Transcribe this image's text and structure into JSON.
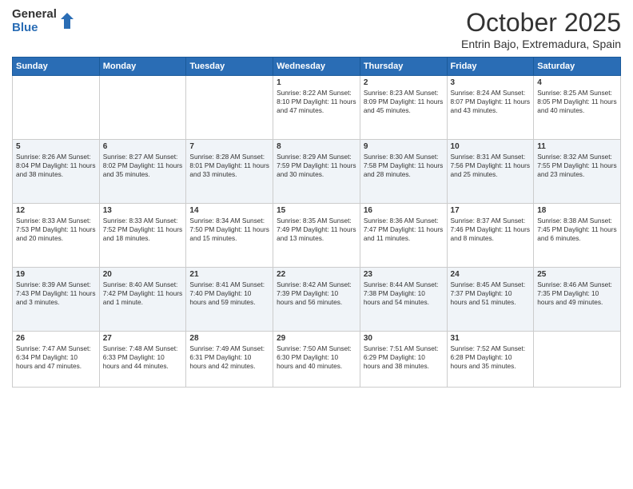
{
  "logo": {
    "general": "General",
    "blue": "Blue"
  },
  "title": "October 2025",
  "subtitle": "Entrin Bajo, Extremadura, Spain",
  "days_of_week": [
    "Sunday",
    "Monday",
    "Tuesday",
    "Wednesday",
    "Thursday",
    "Friday",
    "Saturday"
  ],
  "weeks": [
    [
      {
        "day": "",
        "info": ""
      },
      {
        "day": "",
        "info": ""
      },
      {
        "day": "",
        "info": ""
      },
      {
        "day": "1",
        "info": "Sunrise: 8:22 AM\nSunset: 8:10 PM\nDaylight: 11 hours and 47 minutes."
      },
      {
        "day": "2",
        "info": "Sunrise: 8:23 AM\nSunset: 8:09 PM\nDaylight: 11 hours and 45 minutes."
      },
      {
        "day": "3",
        "info": "Sunrise: 8:24 AM\nSunset: 8:07 PM\nDaylight: 11 hours and 43 minutes."
      },
      {
        "day": "4",
        "info": "Sunrise: 8:25 AM\nSunset: 8:05 PM\nDaylight: 11 hours and 40 minutes."
      }
    ],
    [
      {
        "day": "5",
        "info": "Sunrise: 8:26 AM\nSunset: 8:04 PM\nDaylight: 11 hours and 38 minutes."
      },
      {
        "day": "6",
        "info": "Sunrise: 8:27 AM\nSunset: 8:02 PM\nDaylight: 11 hours and 35 minutes."
      },
      {
        "day": "7",
        "info": "Sunrise: 8:28 AM\nSunset: 8:01 PM\nDaylight: 11 hours and 33 minutes."
      },
      {
        "day": "8",
        "info": "Sunrise: 8:29 AM\nSunset: 7:59 PM\nDaylight: 11 hours and 30 minutes."
      },
      {
        "day": "9",
        "info": "Sunrise: 8:30 AM\nSunset: 7:58 PM\nDaylight: 11 hours and 28 minutes."
      },
      {
        "day": "10",
        "info": "Sunrise: 8:31 AM\nSunset: 7:56 PM\nDaylight: 11 hours and 25 minutes."
      },
      {
        "day": "11",
        "info": "Sunrise: 8:32 AM\nSunset: 7:55 PM\nDaylight: 11 hours and 23 minutes."
      }
    ],
    [
      {
        "day": "12",
        "info": "Sunrise: 8:33 AM\nSunset: 7:53 PM\nDaylight: 11 hours and 20 minutes."
      },
      {
        "day": "13",
        "info": "Sunrise: 8:33 AM\nSunset: 7:52 PM\nDaylight: 11 hours and 18 minutes."
      },
      {
        "day": "14",
        "info": "Sunrise: 8:34 AM\nSunset: 7:50 PM\nDaylight: 11 hours and 15 minutes."
      },
      {
        "day": "15",
        "info": "Sunrise: 8:35 AM\nSunset: 7:49 PM\nDaylight: 11 hours and 13 minutes."
      },
      {
        "day": "16",
        "info": "Sunrise: 8:36 AM\nSunset: 7:47 PM\nDaylight: 11 hours and 11 minutes."
      },
      {
        "day": "17",
        "info": "Sunrise: 8:37 AM\nSunset: 7:46 PM\nDaylight: 11 hours and 8 minutes."
      },
      {
        "day": "18",
        "info": "Sunrise: 8:38 AM\nSunset: 7:45 PM\nDaylight: 11 hours and 6 minutes."
      }
    ],
    [
      {
        "day": "19",
        "info": "Sunrise: 8:39 AM\nSunset: 7:43 PM\nDaylight: 11 hours and 3 minutes."
      },
      {
        "day": "20",
        "info": "Sunrise: 8:40 AM\nSunset: 7:42 PM\nDaylight: 11 hours and 1 minute."
      },
      {
        "day": "21",
        "info": "Sunrise: 8:41 AM\nSunset: 7:40 PM\nDaylight: 10 hours and 59 minutes."
      },
      {
        "day": "22",
        "info": "Sunrise: 8:42 AM\nSunset: 7:39 PM\nDaylight: 10 hours and 56 minutes."
      },
      {
        "day": "23",
        "info": "Sunrise: 8:44 AM\nSunset: 7:38 PM\nDaylight: 10 hours and 54 minutes."
      },
      {
        "day": "24",
        "info": "Sunrise: 8:45 AM\nSunset: 7:37 PM\nDaylight: 10 hours and 51 minutes."
      },
      {
        "day": "25",
        "info": "Sunrise: 8:46 AM\nSunset: 7:35 PM\nDaylight: 10 hours and 49 minutes."
      }
    ],
    [
      {
        "day": "26",
        "info": "Sunrise: 7:47 AM\nSunset: 6:34 PM\nDaylight: 10 hours and 47 minutes."
      },
      {
        "day": "27",
        "info": "Sunrise: 7:48 AM\nSunset: 6:33 PM\nDaylight: 10 hours and 44 minutes."
      },
      {
        "day": "28",
        "info": "Sunrise: 7:49 AM\nSunset: 6:31 PM\nDaylight: 10 hours and 42 minutes."
      },
      {
        "day": "29",
        "info": "Sunrise: 7:50 AM\nSunset: 6:30 PM\nDaylight: 10 hours and 40 minutes."
      },
      {
        "day": "30",
        "info": "Sunrise: 7:51 AM\nSunset: 6:29 PM\nDaylight: 10 hours and 38 minutes."
      },
      {
        "day": "31",
        "info": "Sunrise: 7:52 AM\nSunset: 6:28 PM\nDaylight: 10 hours and 35 minutes."
      },
      {
        "day": "",
        "info": ""
      }
    ]
  ]
}
